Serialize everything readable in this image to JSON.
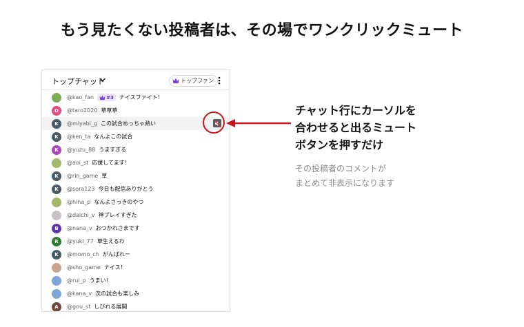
{
  "headline": "もう見たくない投稿者は、その場でワンクリックミュート",
  "chat": {
    "title": "トップチャット",
    "filter_badge": "トップファン",
    "messages": [
      {
        "author": "@kao_fan",
        "text": "ナイスファイト！",
        "avatar": "",
        "avatar_color": "#7cae5a",
        "rank": "#3"
      },
      {
        "author": "@taro2020",
        "text": "草草草",
        "avatar": "O",
        "avatar_color": "#e64a7e"
      },
      {
        "author": "@miyabi_g",
        "text": "この試合めっちゃ熱い",
        "avatar": "K",
        "avatar_color": "#4a5a63",
        "hovered": true
      },
      {
        "author": "@ken_ta",
        "text": "なんよこの試合",
        "avatar": "K",
        "avatar_color": "#4a5a63"
      },
      {
        "author": "@yuzu_88",
        "text": "うますぎる",
        "avatar": "K",
        "avatar_color": "#ab47bc"
      },
      {
        "author": "@aoi_st",
        "text": "応援してます！",
        "avatar": "",
        "avatar_color": "#a3b86c"
      },
      {
        "author": "@rin_game",
        "text": "草",
        "avatar": "K",
        "avatar_color": "#4a5a63"
      },
      {
        "author": "@sora123",
        "text": "今日も配信ありがとう",
        "avatar": "K",
        "avatar_color": "#4a5a63"
      },
      {
        "author": "@hina_p",
        "text": "なんよさっきのやつ",
        "avatar": "",
        "avatar_color": "#a3b86c"
      },
      {
        "author": "@daichi_v",
        "text": "神プレイすぎた",
        "avatar": "",
        "avatar_color": "#c9c3c8"
      },
      {
        "author": "@nana_v",
        "text": "おつかれさまです",
        "avatar": "B",
        "avatar_color": "#5e35b1"
      },
      {
        "author": "@yuki_77",
        "text": "草生えるわ",
        "avatar": "R",
        "avatar_color": "#2e7d32"
      },
      {
        "author": "@momo_ch",
        "text": "がんばれー",
        "avatar": "K",
        "avatar_color": "#4a5a63"
      },
      {
        "author": "@sho_game",
        "text": "ナイス！",
        "avatar": "",
        "avatar_color": "#c8a590"
      },
      {
        "author": "@rui_p",
        "text": "うまい！",
        "avatar": "",
        "avatar_color": "#7fa6d8"
      },
      {
        "author": "@kana_v",
        "text": "次の試合も楽しみ",
        "avatar": "",
        "avatar_color": "#7fa6d8"
      },
      {
        "author": "@gou_st",
        "text": "しびれる展開",
        "avatar": "A",
        "avatar_color": "#6d4c41"
      }
    ]
  },
  "callout": {
    "title_lines": [
      "チャット行にカーソルを",
      "合わせると出るミュート",
      "ボタンを押すだけ"
    ],
    "sub_lines": [
      "その投稿者のコメントが",
      "まとめて非表示になります"
    ]
  },
  "colors": {
    "accent_red": "#c8141b",
    "crown_purple": "#7b3fe4"
  },
  "icons": {
    "mute": "mute-icon",
    "crown": "crown-icon",
    "menu": "kebab-icon"
  }
}
